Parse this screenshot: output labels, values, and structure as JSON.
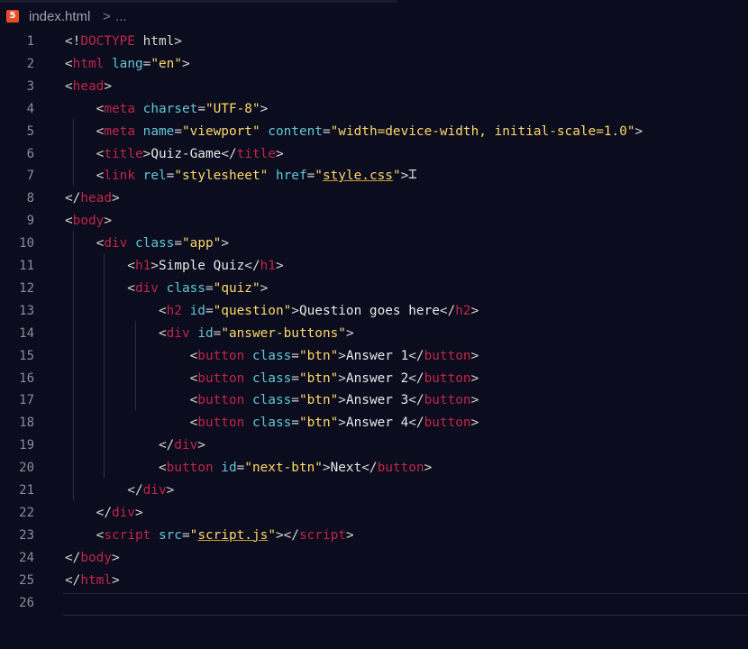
{
  "breadcrumb": {
    "file_icon": "html5-icon",
    "file_icon_glyph": "5",
    "file_name": "index.html",
    "separator": ">",
    "rest": "..."
  },
  "editor": {
    "line_numbers": [
      "1",
      "2",
      "3",
      "4",
      "5",
      "6",
      "7",
      "8",
      "9",
      "10",
      "11",
      "12",
      "13",
      "14",
      "15",
      "16",
      "17",
      "18",
      "19",
      "20",
      "21",
      "22",
      "23",
      "24",
      "25",
      "26"
    ],
    "lines": [
      [
        [
          "p",
          "<!"
        ],
        [
          "tag",
          "DOCTYPE"
        ],
        [
          "p",
          " html>"
        ]
      ],
      [
        [
          "p",
          "<"
        ],
        [
          "tag",
          "html"
        ],
        [
          "p",
          " "
        ],
        [
          "attr",
          "lang"
        ],
        [
          "p",
          "="
        ],
        [
          "str",
          "\"en\""
        ],
        [
          "p",
          ">"
        ]
      ],
      [
        [
          "p",
          "<"
        ],
        [
          "tag",
          "head"
        ],
        [
          "p",
          ">"
        ]
      ],
      [
        [
          "p",
          "    <"
        ],
        [
          "tag",
          "meta"
        ],
        [
          "p",
          " "
        ],
        [
          "attr",
          "charset"
        ],
        [
          "p",
          "="
        ],
        [
          "str",
          "\"UTF-8\""
        ],
        [
          "p",
          ">"
        ]
      ],
      [
        [
          "p",
          "    <"
        ],
        [
          "tag",
          "meta"
        ],
        [
          "p",
          " "
        ],
        [
          "attr",
          "name"
        ],
        [
          "p",
          "="
        ],
        [
          "str",
          "\"viewport\""
        ],
        [
          "p",
          " "
        ],
        [
          "attr",
          "content"
        ],
        [
          "p",
          "="
        ],
        [
          "str",
          "\"width=device-width, initial-scale=1.0\""
        ],
        [
          "p",
          ">"
        ]
      ],
      [
        [
          "p",
          "    <"
        ],
        [
          "tag",
          "title"
        ],
        [
          "p",
          ">"
        ],
        [
          "txt",
          "Quiz-Game"
        ],
        [
          "p",
          "</"
        ],
        [
          "tag",
          "title"
        ],
        [
          "p",
          ">"
        ]
      ],
      [
        [
          "p",
          "    <"
        ],
        [
          "tag",
          "link"
        ],
        [
          "p",
          " "
        ],
        [
          "attr",
          "rel"
        ],
        [
          "p",
          "="
        ],
        [
          "str",
          "\"stylesheet\""
        ],
        [
          "p",
          " "
        ],
        [
          "attr",
          "href"
        ],
        [
          "p",
          "="
        ],
        [
          "str",
          "\""
        ],
        [
          "strlink",
          "style.css"
        ],
        [
          "str",
          "\""
        ],
        [
          "p",
          ">"
        ]
      ],
      [
        [
          "p",
          "</"
        ],
        [
          "tag",
          "head"
        ],
        [
          "p",
          ">"
        ]
      ],
      [
        [
          "p",
          "<"
        ],
        [
          "tag",
          "body"
        ],
        [
          "p",
          ">"
        ]
      ],
      [
        [
          "p",
          "    <"
        ],
        [
          "tag",
          "div"
        ],
        [
          "p",
          " "
        ],
        [
          "attr",
          "class"
        ],
        [
          "p",
          "="
        ],
        [
          "str",
          "\"app\""
        ],
        [
          "p",
          ">"
        ]
      ],
      [
        [
          "p",
          "        <"
        ],
        [
          "tag",
          "h1"
        ],
        [
          "p",
          ">"
        ],
        [
          "txt",
          "Simple Quiz"
        ],
        [
          "p",
          "</"
        ],
        [
          "tag",
          "h1"
        ],
        [
          "p",
          ">"
        ]
      ],
      [
        [
          "p",
          "        <"
        ],
        [
          "tag",
          "div"
        ],
        [
          "p",
          " "
        ],
        [
          "attr",
          "class"
        ],
        [
          "p",
          "="
        ],
        [
          "str",
          "\"quiz\""
        ],
        [
          "p",
          ">"
        ]
      ],
      [
        [
          "p",
          "            <"
        ],
        [
          "tag",
          "h2"
        ],
        [
          "p",
          " "
        ],
        [
          "attr",
          "id"
        ],
        [
          "p",
          "="
        ],
        [
          "str",
          "\"question\""
        ],
        [
          "p",
          ">"
        ],
        [
          "txt",
          "Question goes here"
        ],
        [
          "p",
          "</"
        ],
        [
          "tag",
          "h2"
        ],
        [
          "p",
          ">"
        ]
      ],
      [
        [
          "p",
          "            <"
        ],
        [
          "tag",
          "div"
        ],
        [
          "p",
          " "
        ],
        [
          "attr",
          "id"
        ],
        [
          "p",
          "="
        ],
        [
          "str",
          "\"answer-buttons\""
        ],
        [
          "p",
          ">"
        ]
      ],
      [
        [
          "p",
          "                <"
        ],
        [
          "tag",
          "button"
        ],
        [
          "p",
          " "
        ],
        [
          "attr",
          "class"
        ],
        [
          "p",
          "="
        ],
        [
          "str",
          "\"btn\""
        ],
        [
          "p",
          ">"
        ],
        [
          "txt",
          "Answer 1"
        ],
        [
          "p",
          "</"
        ],
        [
          "tag",
          "button"
        ],
        [
          "p",
          ">"
        ]
      ],
      [
        [
          "p",
          "                <"
        ],
        [
          "tag",
          "button"
        ],
        [
          "p",
          " "
        ],
        [
          "attr",
          "class"
        ],
        [
          "p",
          "="
        ],
        [
          "str",
          "\"btn\""
        ],
        [
          "p",
          ">"
        ],
        [
          "txt",
          "Answer 2"
        ],
        [
          "p",
          "</"
        ],
        [
          "tag",
          "button"
        ],
        [
          "p",
          ">"
        ]
      ],
      [
        [
          "p",
          "                <"
        ],
        [
          "tag",
          "button"
        ],
        [
          "p",
          " "
        ],
        [
          "attr",
          "class"
        ],
        [
          "p",
          "="
        ],
        [
          "str",
          "\"btn\""
        ],
        [
          "p",
          ">"
        ],
        [
          "txt",
          "Answer 3"
        ],
        [
          "p",
          "</"
        ],
        [
          "tag",
          "button"
        ],
        [
          "p",
          ">"
        ]
      ],
      [
        [
          "p",
          "                <"
        ],
        [
          "tag",
          "button"
        ],
        [
          "p",
          " "
        ],
        [
          "attr",
          "class"
        ],
        [
          "p",
          "="
        ],
        [
          "str",
          "\"btn\""
        ],
        [
          "p",
          ">"
        ],
        [
          "txt",
          "Answer 4"
        ],
        [
          "p",
          "</"
        ],
        [
          "tag",
          "button"
        ],
        [
          "p",
          ">"
        ]
      ],
      [
        [
          "p",
          "            </"
        ],
        [
          "tag",
          "div"
        ],
        [
          "p",
          ">"
        ]
      ],
      [
        [
          "p",
          "            <"
        ],
        [
          "tag",
          "button"
        ],
        [
          "p",
          " "
        ],
        [
          "attr",
          "id"
        ],
        [
          "p",
          "="
        ],
        [
          "str",
          "\"next-btn\""
        ],
        [
          "p",
          ">"
        ],
        [
          "txt",
          "Next"
        ],
        [
          "p",
          "</"
        ],
        [
          "tag",
          "button"
        ],
        [
          "p",
          ">"
        ]
      ],
      [
        [
          "p",
          "        </"
        ],
        [
          "tag",
          "div"
        ],
        [
          "p",
          ">"
        ]
      ],
      [
        [
          "p",
          "    </"
        ],
        [
          "tag",
          "div"
        ],
        [
          "p",
          ">"
        ]
      ],
      [
        [
          "p",
          "    <"
        ],
        [
          "tag",
          "script"
        ],
        [
          "p",
          " "
        ],
        [
          "attr",
          "src"
        ],
        [
          "p",
          "="
        ],
        [
          "str",
          "\""
        ],
        [
          "strlink",
          "script.js"
        ],
        [
          "str",
          "\""
        ],
        [
          "p",
          "></"
        ],
        [
          "tag",
          "script"
        ],
        [
          "p",
          ">"
        ]
      ],
      [
        [
          "p",
          "</"
        ],
        [
          "tag",
          "body"
        ],
        [
          "p",
          ">"
        ]
      ],
      [
        [
          "p",
          "</"
        ],
        [
          "tag",
          "html"
        ],
        [
          "p",
          ">"
        ]
      ],
      []
    ]
  },
  "colors": {
    "background": "#0b0c1d",
    "tag": "#c0264a",
    "attribute": "#60c8d8",
    "string": "#ffd86a",
    "text": "#e8e8e8",
    "line_number": "#8a8d9c"
  }
}
